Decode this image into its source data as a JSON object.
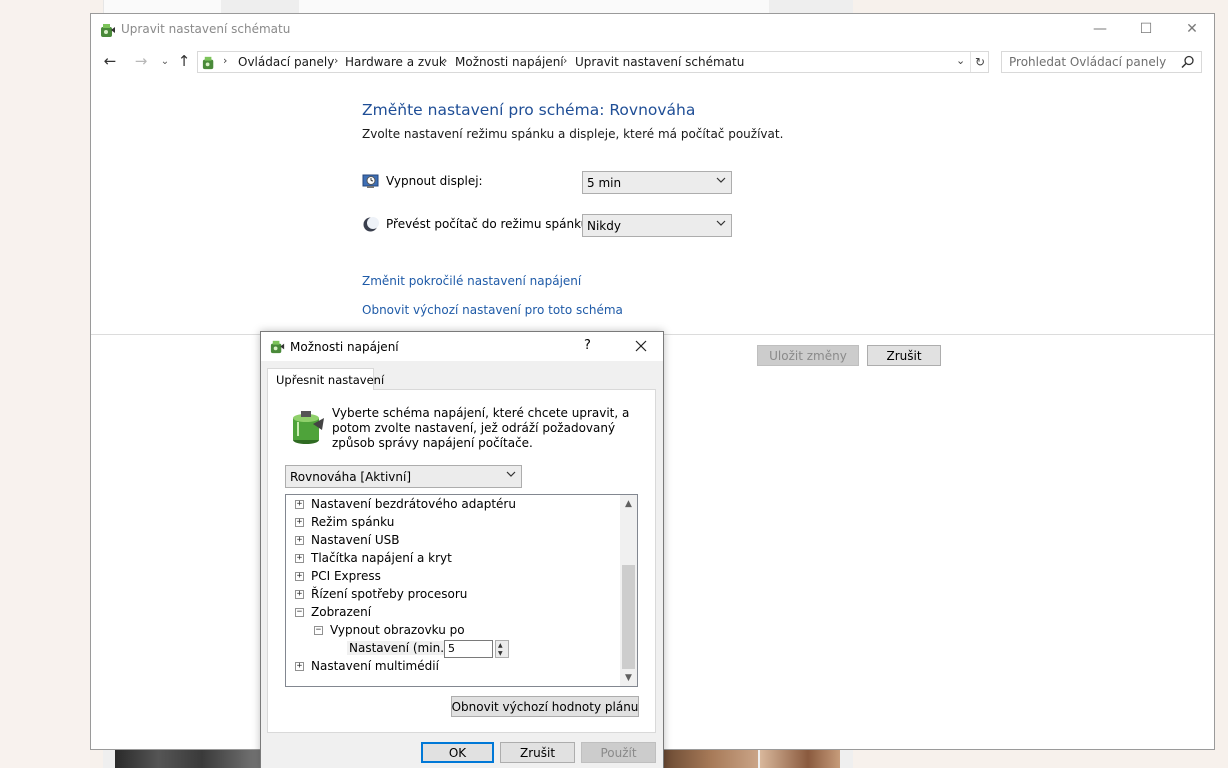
{
  "window": {
    "title": "Upravit nastavení schématu",
    "minimize_glyph": "—",
    "maximize_glyph": "☐",
    "close_glyph": "✕"
  },
  "nav": {
    "back_glyph": "←",
    "forward_glyph": "→",
    "recent_glyph": "⌄",
    "up_glyph": "↑",
    "breadcrumbs": [
      "Ovládací panely",
      "Hardware a zvuk",
      "Možnosti napájení",
      "Upravit nastavení schématu"
    ],
    "separator": "›",
    "dropdown_glyph": "⌄",
    "refresh_glyph": "↻",
    "search_placeholder": "Prohledat Ovládací panely"
  },
  "content": {
    "heading": "Změňte nastavení pro schéma: Rovnováha",
    "subheading": "Zvolte nastavení režimu spánku a displeje, které má počítač používat.",
    "display_label": "Vypnout displej:",
    "display_value": "5 min",
    "sleep_label": "Převést počítač do režimu spánku:",
    "sleep_value": "Nikdy",
    "link_advanced": "Změnit pokročilé nastavení napájení",
    "link_restore": "Obnovit výchozí nastavení pro toto schéma",
    "save_button": "Uložit změny",
    "cancel_button": "Zrušit"
  },
  "dialog": {
    "title": "Možnosti napájení",
    "help_glyph": "?",
    "tab_label": "Upřesnit nastavení",
    "description": "Vyberte schéma napájení, které chcete upravit, a potom zvolte nastavení, jež odráží požadovaný způsob správy napájení počítače.",
    "scheme_value": "Rovnováha [Aktivní]",
    "tree": [
      {
        "label": "Nastavení bezdrátového adaptéru",
        "toggle": "+"
      },
      {
        "label": "Režim spánku",
        "toggle": "+"
      },
      {
        "label": "Nastavení USB",
        "toggle": "+"
      },
      {
        "label": "Tlačítka napájení a kryt",
        "toggle": "+"
      },
      {
        "label": "PCI Express",
        "toggle": "+"
      },
      {
        "label": "Řízení spotřeby procesoru",
        "toggle": "+"
      },
      {
        "label": "Zobrazení",
        "toggle": "−"
      },
      {
        "label": "Vypnout obrazovku po",
        "toggle": "−"
      },
      {
        "label": "Nastavení multimédií",
        "toggle": "+"
      }
    ],
    "setting_label": "Nastavení (min.):",
    "setting_value": "5",
    "scroll_up_glyph": "▲",
    "scroll_down_glyph": "▼",
    "spin_up_glyph": "▲",
    "spin_down_glyph": "▼",
    "restore_defaults_button": "Obnovit výchozí hodnoty plánu",
    "ok_button": "OK",
    "cancel_button": "Zrušit",
    "apply_button": "Použít"
  }
}
